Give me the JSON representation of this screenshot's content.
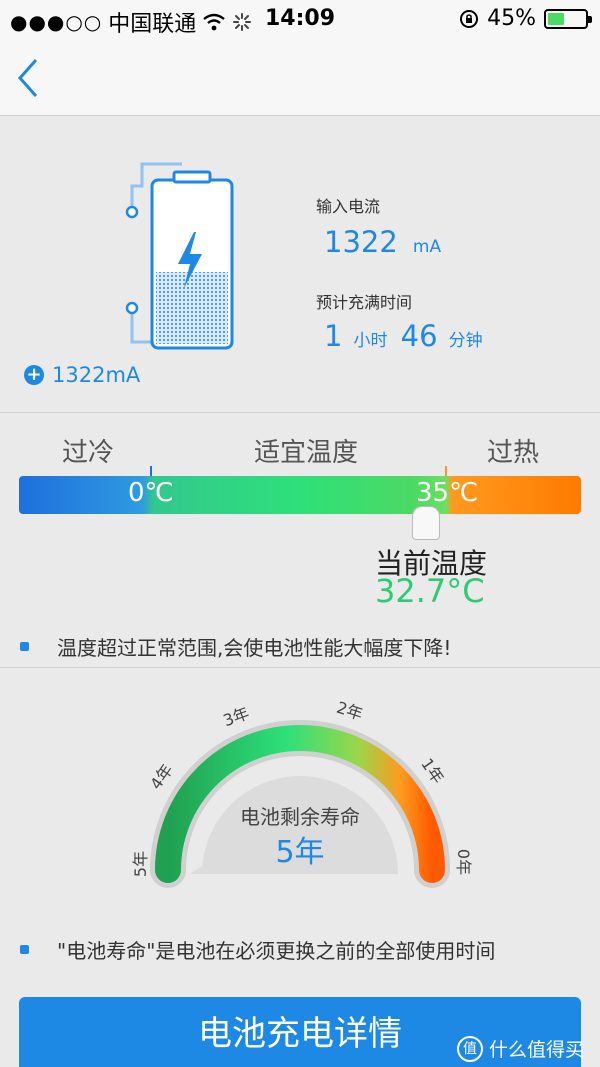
{
  "status": {
    "signal": "●●●○○",
    "carrier": "中国联通",
    "time": "14:09",
    "battery_percent": "45%",
    "battery_level": 0.45
  },
  "battery": {
    "current_tag": "1322mA",
    "input_current_label": "输入电流",
    "input_current_value": "1322",
    "input_current_unit": "mA",
    "full_time_label": "预计充满时间",
    "hours_value": "1",
    "hours_unit": "小时",
    "minutes_value": "46",
    "minutes_unit": "分钟",
    "fill_level": 0.45
  },
  "temperature": {
    "cold_label": "过冷",
    "ok_label": "适宜温度",
    "hot_label": "过热",
    "low_mark": "0℃",
    "high_mark": "35℃",
    "current_label": "当前温度",
    "current_value": "32.7°C",
    "note": "温度超过正常范围,会使电池性能大幅度下降!"
  },
  "life": {
    "title": "电池剩余寿命",
    "value": "5年",
    "ticks": [
      "5年",
      "4年",
      "3年",
      "2年",
      "1年",
      "0年"
    ],
    "note": "\"电池寿命\"是电池在必须更换之前的全部使用时间"
  },
  "cta_label": "电池充电详情",
  "watermark": "什么值得买",
  "colors": {
    "accent": "#1e88e5",
    "good": "#2ecc71",
    "hot": "#ff7a00"
  }
}
